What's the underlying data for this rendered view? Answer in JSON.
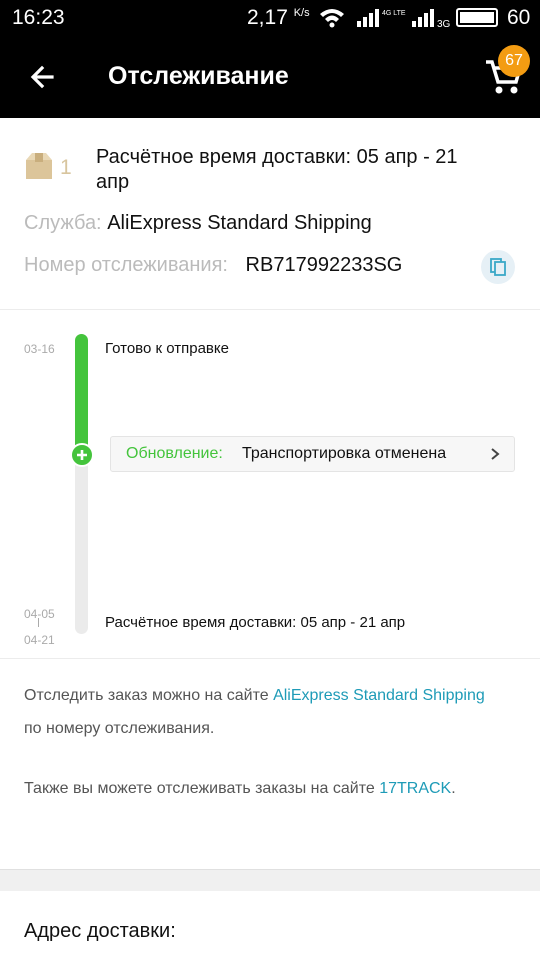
{
  "status_bar": {
    "time": "16:23",
    "speed": "2,17",
    "speed_unit": "K/s",
    "network_1": "4G LTE",
    "network_2": "3G",
    "battery": "60"
  },
  "app_bar": {
    "title": "Отслеживание",
    "cart_count": "67",
    "back_icon": "arrow-back-icon",
    "cart_icon": "shopping-cart-icon"
  },
  "shipment": {
    "package_count": "1",
    "estimated_delivery": "Расчётное время доставки: 05 апр - 21 апр",
    "service_label": "Служба:",
    "service_value": "AliExpress Standard Shipping",
    "tracking_label": "Номер отслеживания:",
    "tracking_value": "RB717992233SG"
  },
  "timeline": {
    "start_date": "03-16",
    "start_event": "Готово к отправке",
    "update_label": "Обновление:",
    "update_value": "Транспортировка отменена",
    "end_date_from": "04-05",
    "end_date_to": "04-21",
    "end_event": "Расчётное время доставки: 05 апр - 21 апр"
  },
  "info": {
    "p1_before": "Отследить заказ можно на сайте ",
    "p1_link": "AliExpress Standard Shipping",
    "p1_after": " по номеру отслеживания.",
    "p2_before": "Также вы можете отслеживать заказы на сайте ",
    "p2_link": "17TRACK",
    "p2_after": "."
  },
  "address": {
    "title": "Адрес доставки:"
  },
  "colors": {
    "accent_green": "#44c43c",
    "link": "#1e9bb7",
    "badge": "#f39c12"
  }
}
